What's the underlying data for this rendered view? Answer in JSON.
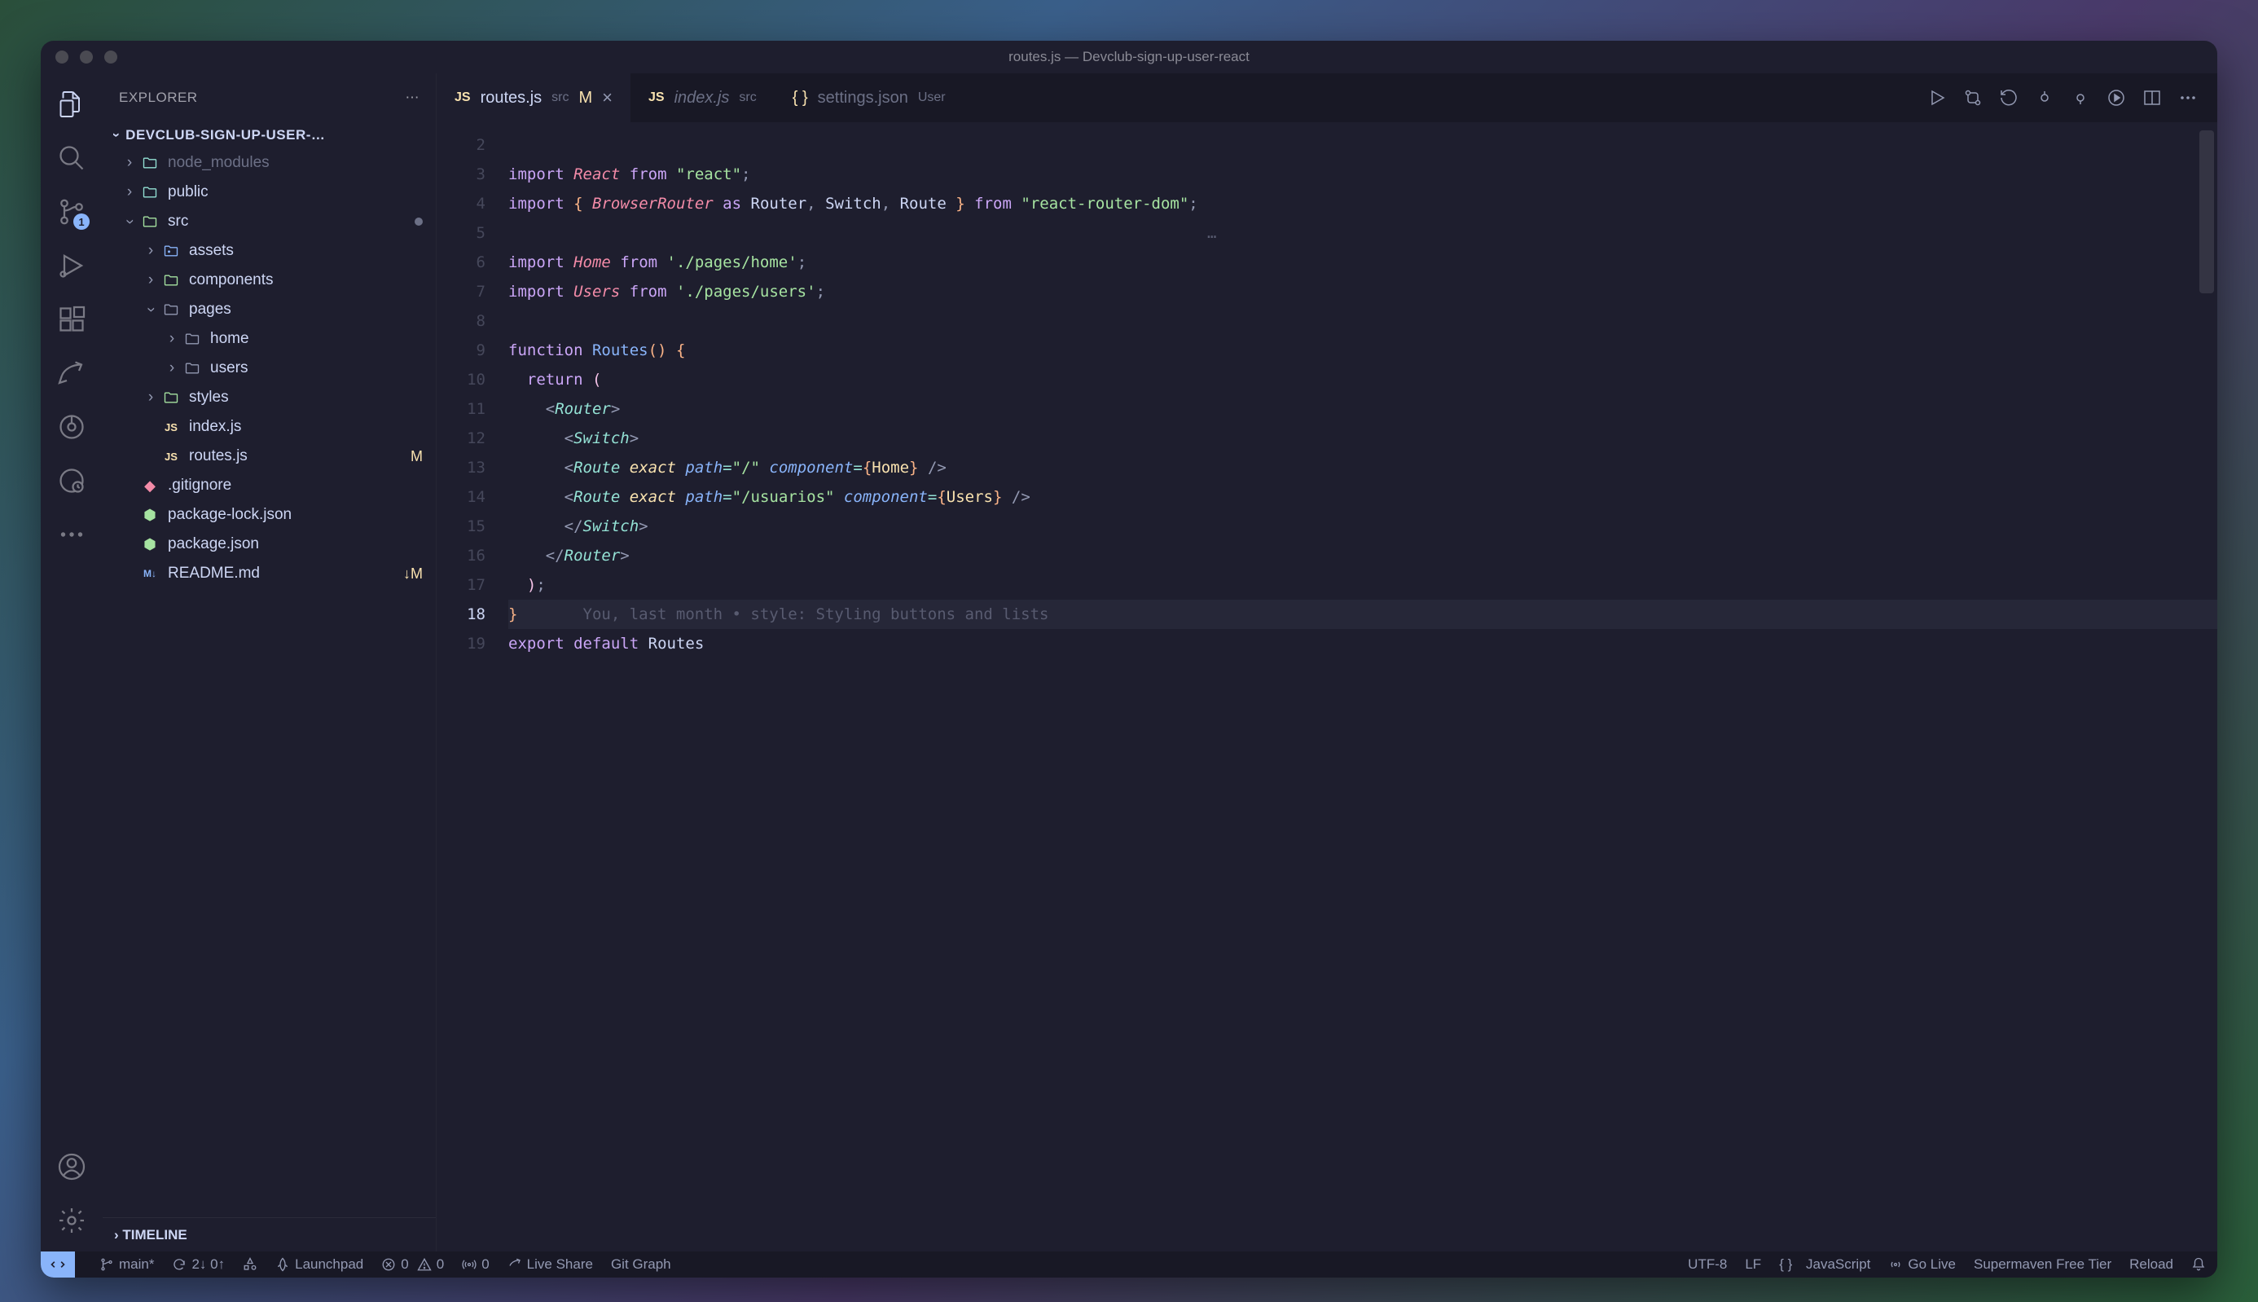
{
  "window": {
    "title": "routes.js — Devclub-sign-up-user-react"
  },
  "sidebar": {
    "header": "EXPLORER",
    "project": "DEVCLUB-SIGN-UP-USER-…",
    "timeline": "TIMELINE",
    "tree": [
      {
        "depth": 0,
        "chev": "right",
        "icon": "folder-teal",
        "label": "node_modules",
        "dim": true
      },
      {
        "depth": 0,
        "chev": "right",
        "icon": "folder-teal",
        "label": "public"
      },
      {
        "depth": 0,
        "chev": "down",
        "icon": "folder-green",
        "label": "src",
        "dot": true
      },
      {
        "depth": 1,
        "chev": "right",
        "icon": "folder-assets",
        "label": "assets"
      },
      {
        "depth": 1,
        "chev": "right",
        "icon": "folder-green",
        "label": "components"
      },
      {
        "depth": 1,
        "chev": "down",
        "icon": "folder",
        "label": "pages"
      },
      {
        "depth": 2,
        "chev": "right",
        "icon": "folder",
        "label": "home"
      },
      {
        "depth": 2,
        "chev": "right",
        "icon": "folder",
        "label": "users"
      },
      {
        "depth": 1,
        "chev": "right",
        "icon": "folder-green",
        "label": "styles"
      },
      {
        "depth": 1,
        "chev": "",
        "icon": "js",
        "label": "index.js"
      },
      {
        "depth": 1,
        "chev": "",
        "icon": "js",
        "label": "routes.js",
        "mod": "M"
      },
      {
        "depth": 0,
        "chev": "",
        "icon": "git",
        "label": ".gitignore"
      },
      {
        "depth": 0,
        "chev": "",
        "icon": "node",
        "label": "package-lock.json"
      },
      {
        "depth": 0,
        "chev": "",
        "icon": "node",
        "label": "package.json"
      },
      {
        "depth": 0,
        "chev": "",
        "icon": "md",
        "label": "README.md",
        "mod": "↓M"
      }
    ]
  },
  "activity": {
    "scm_badge": "1"
  },
  "tabs": [
    {
      "icon": "js",
      "name": "routes.js",
      "sub": "src",
      "mod": "M",
      "active": true,
      "close": true
    },
    {
      "icon": "js",
      "name": "index.js",
      "sub": "src",
      "italic": true
    },
    {
      "icon": "json",
      "name": "settings.json",
      "sub": "User"
    }
  ],
  "editor": {
    "line_start": 2,
    "current_line": 18,
    "ghost_annotation": "You, last month • style: Styling buttons and lists",
    "tokens": {
      "import": "import",
      "react": "React",
      "from": "from",
      "s_react": "\"react\"",
      "browser_router": "BrowserRouter",
      "as": "as",
      "router": "Router",
      "switch": "Switch",
      "route": "Route",
      "s_rrd": "\"react-router-dom\"",
      "home": "Home",
      "s_home": "'./pages/home'",
      "users": "Users",
      "s_users": "'./pages/users'",
      "function": "function",
      "routes_fn": "Routes",
      "return": "return",
      "path": "path",
      "exact": "exact",
      "s_root": "\"/\"",
      "component": "component",
      "s_usuarios": "\"/usuarios\"",
      "export": "export",
      "default": "default",
      "ellipsis": "…"
    }
  },
  "statusbar": {
    "branch": "main*",
    "sync": "2↓ 0↑",
    "launchpad": "Launchpad",
    "errors": "0",
    "warnings": "0",
    "radio": "0",
    "liveshare": "Live Share",
    "gitgraph": "Git Graph",
    "encoding": "UTF-8",
    "eol": "LF",
    "lang": "JavaScript",
    "golive": "Go Live",
    "supermaven": "Supermaven Free Tier",
    "reload": "Reload"
  }
}
